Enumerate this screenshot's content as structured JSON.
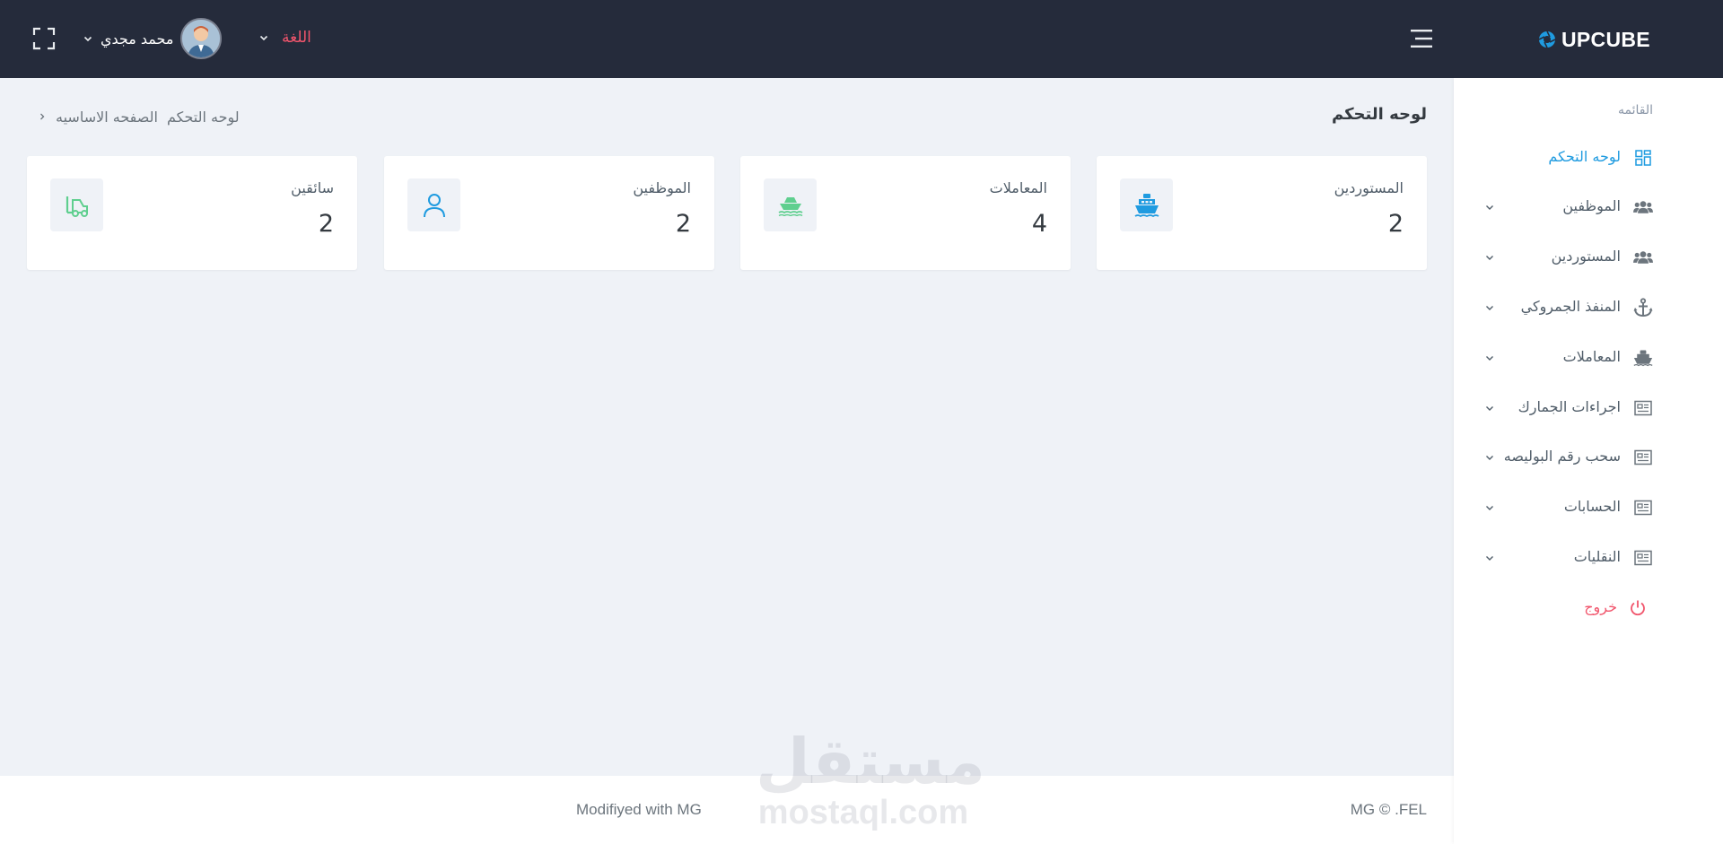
{
  "topbar": {
    "brand": "UPCUBE",
    "language_label": "اللغة",
    "user_name": "محمد مجدي"
  },
  "sidebar": {
    "menu_title": "القائمه",
    "items": [
      {
        "label": "لوحه التحكم",
        "icon": "dashboard-grid-icon",
        "active": true
      },
      {
        "label": "الموظفين",
        "icon": "users-icon"
      },
      {
        "label": "المستوردين",
        "icon": "users-icon"
      },
      {
        "label": "المنفذ الجمروكي",
        "icon": "anchor-icon"
      },
      {
        "label": "المعاملات",
        "icon": "ship-icon"
      },
      {
        "label": "اجراءات الجمارك",
        "icon": "newspaper-icon"
      },
      {
        "label": "سحب رقم البوليصه",
        "icon": "newspaper-icon"
      },
      {
        "label": "الحسابات",
        "icon": "newspaper-icon"
      },
      {
        "label": "النقليات",
        "icon": "newspaper-icon"
      }
    ],
    "logout_label": "خروج"
  },
  "page": {
    "title": "لوحه التحكم",
    "breadcrumb": [
      "لوحه التحكم",
      "الصفحه الاساسيه"
    ]
  },
  "cards": [
    {
      "label": "المستوردين",
      "value": "2",
      "icon": "ship-icon",
      "icon_color": "#1f9be0"
    },
    {
      "label": "المعاملات",
      "value": "4",
      "icon": "ship-sea-icon",
      "icon_color": "#5fcf8f"
    },
    {
      "label": "الموظفين",
      "value": "2",
      "icon": "user-icon",
      "icon_color": "#1f9be0"
    },
    {
      "label": "سائقين",
      "value": "2",
      "icon": "forklift-icon",
      "icon_color": "#5fcf8f"
    }
  ],
  "footer": {
    "left": "Modifiyed with MG",
    "right": "MG © .FEL"
  },
  "watermark": {
    "arabic": "مستقل",
    "latin": "mostaql.com"
  },
  "colors": {
    "topbar_bg": "#252b3b",
    "accent": "#1f9be0",
    "danger": "#f1556c",
    "success": "#5fcf8f",
    "content_bg": "#eff2f7"
  }
}
